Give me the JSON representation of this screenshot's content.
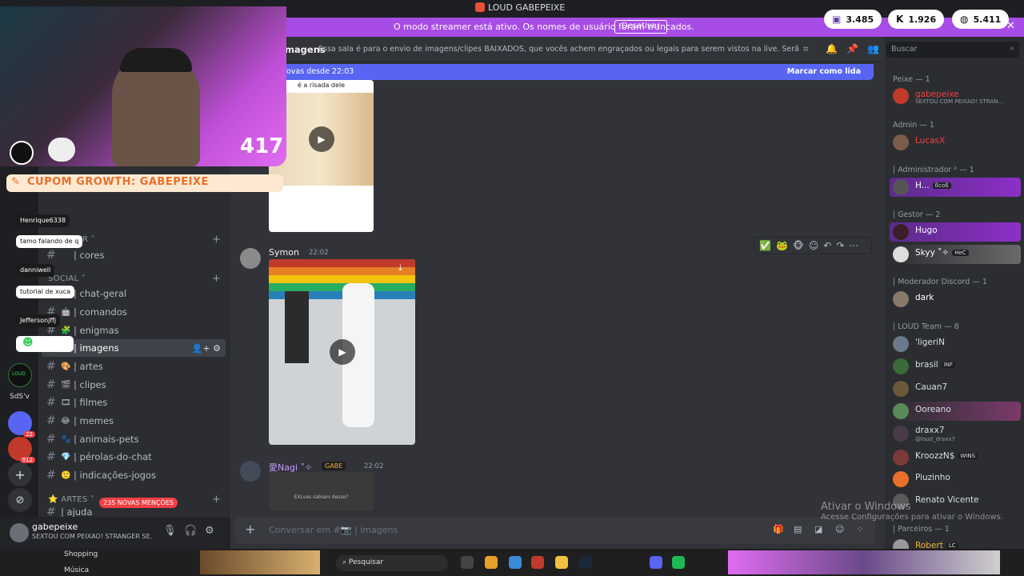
{
  "window": {
    "title": "LOUD GABEPEIXE"
  },
  "banner": {
    "text": "O modo streamer está ativo. Os nomes de usuário foram truncados.",
    "button": "Desativar"
  },
  "counters": [
    {
      "icon": "twitch-icon",
      "value": "3.485"
    },
    {
      "icon": "kick-icon",
      "value": "1.926"
    },
    {
      "icon": "globe-icon",
      "value": "5.411"
    }
  ],
  "stream": {
    "viewer_number": "417",
    "coupon": "CUPOM GROWTH: GABEPEIXE",
    "chat": [
      "Henrique6338",
      "tamo falando de q",
      "danniwell",
      "tutorial de xuca",
      "Jeffersonjffj"
    ]
  },
  "rail": {
    "badges": [
      "22",
      "912"
    ],
    "labels": [
      "LOUD",
      "SdS'v"
    ]
  },
  "sidebar": {
    "categories": {
      "booster": "BOOSTER",
      "social": "SOCIAL",
      "artes": "ARTES"
    },
    "mentions_badge": "235 NOVAS MENÇÕES",
    "channels": [
      {
        "label": "| cores",
        "emoji": ""
      },
      {
        "label": "| chat-geral",
        "emoji": "💬"
      },
      {
        "label": "| comandos",
        "emoji": "🤖"
      },
      {
        "label": "| enigmas",
        "emoji": "🧩"
      },
      {
        "label": "| imagens",
        "emoji": "📷"
      },
      {
        "label": "| artes",
        "emoji": "🎨"
      },
      {
        "label": "| clipes",
        "emoji": "🎬"
      },
      {
        "label": "| filmes",
        "emoji": "🎞"
      },
      {
        "label": "| memes",
        "emoji": "😂"
      },
      {
        "label": "| animais-pets",
        "emoji": "🐾"
      },
      {
        "label": "| pérolas-do-chat",
        "emoji": "💎"
      },
      {
        "label": "| indicações-jogos",
        "emoji": "🙂"
      },
      {
        "label": "| ajuda",
        "emoji": ""
      }
    ]
  },
  "user": {
    "name": "gabepeixe",
    "status": "SEXTOU COM PEIXAO! STRANGER SE..."
  },
  "channel": {
    "name": "imagens",
    "topic": "Essa sala é para o envio de imagens/clipes BAIXADOS, que vocês achem engraçados ou legais para serem vistos na live. Serão apagados prints de o...",
    "new_since": "s novas desde 22:03",
    "mark_read": "Marcar como lida"
  },
  "messages": [
    {
      "caption": "é a risada dele"
    },
    {
      "author": "Symon",
      "time": "22:02"
    },
    {
      "author": "愛Nagi ˚✧",
      "time": "22:02",
      "tag": "GABE",
      "preview": "EXLves sabiam desse?"
    }
  ],
  "composer": {
    "placeholder": "Conversar em #📷 | imagens"
  },
  "search": {
    "placeholder": "Buscar"
  },
  "members": {
    "groups": [
      {
        "label": "Peixe — 1"
      },
      {
        "label": "Admin — 1"
      },
      {
        "label": "| Administrador ² — 1"
      },
      {
        "label": "| Gestor — 2"
      },
      {
        "label": "| Moderador Discord — 1"
      },
      {
        "label": "| LOUD Team — 8"
      },
      {
        "label": "| Parceiros — 1"
      }
    ],
    "list": [
      {
        "name": "gabepeixe",
        "sub": "SEXTOU COM PEIXAO! STRAN...",
        "color": "#f23f43"
      },
      {
        "name": "LucasX",
        "sub": "",
        "color": "#f23f43"
      },
      {
        "name": "H...",
        "sub": "",
        "tag": "ßcoß",
        "color": "#ffffff"
      },
      {
        "name": "Hugo",
        "sub": "",
        "color": "#ffffff"
      },
      {
        "name": "Skyy ˚✧",
        "sub": "",
        "tag": "HeC",
        "color": "#ffffff"
      },
      {
        "name": "dark",
        "sub": "",
        "color": "#ffffff"
      },
      {
        "name": "'ligeriN",
        "sub": "",
        "color": "#dbdee1"
      },
      {
        "name": "brasil",
        "sub": "",
        "tag": "INF",
        "color": "#dbdee1"
      },
      {
        "name": "Cauan7",
        "sub": "",
        "color": "#dbdee1"
      },
      {
        "name": "Ooreano",
        "sub": "",
        "color": "#dbdee1"
      },
      {
        "name": "draxx7",
        "sub": "@loud_draxx7",
        "color": "#dbdee1"
      },
      {
        "name": "KroozzN$",
        "sub": "",
        "tag": "WINS",
        "color": "#dbdee1"
      },
      {
        "name": "Piuzinho",
        "sub": "",
        "color": "#dbdee1"
      },
      {
        "name": "Renato Vicente",
        "sub": "",
        "color": "#dbdee1"
      },
      {
        "name": "Robert",
        "sub": "",
        "tag": "LC",
        "color": "#f0b232"
      }
    ]
  },
  "windows": {
    "line1": "Ativar o Windows",
    "line2": "Acesse Configurações para ativar o Windows."
  },
  "taskbar": {
    "shopping": "Shopping",
    "music": "Música",
    "search": "Pesquisar"
  }
}
